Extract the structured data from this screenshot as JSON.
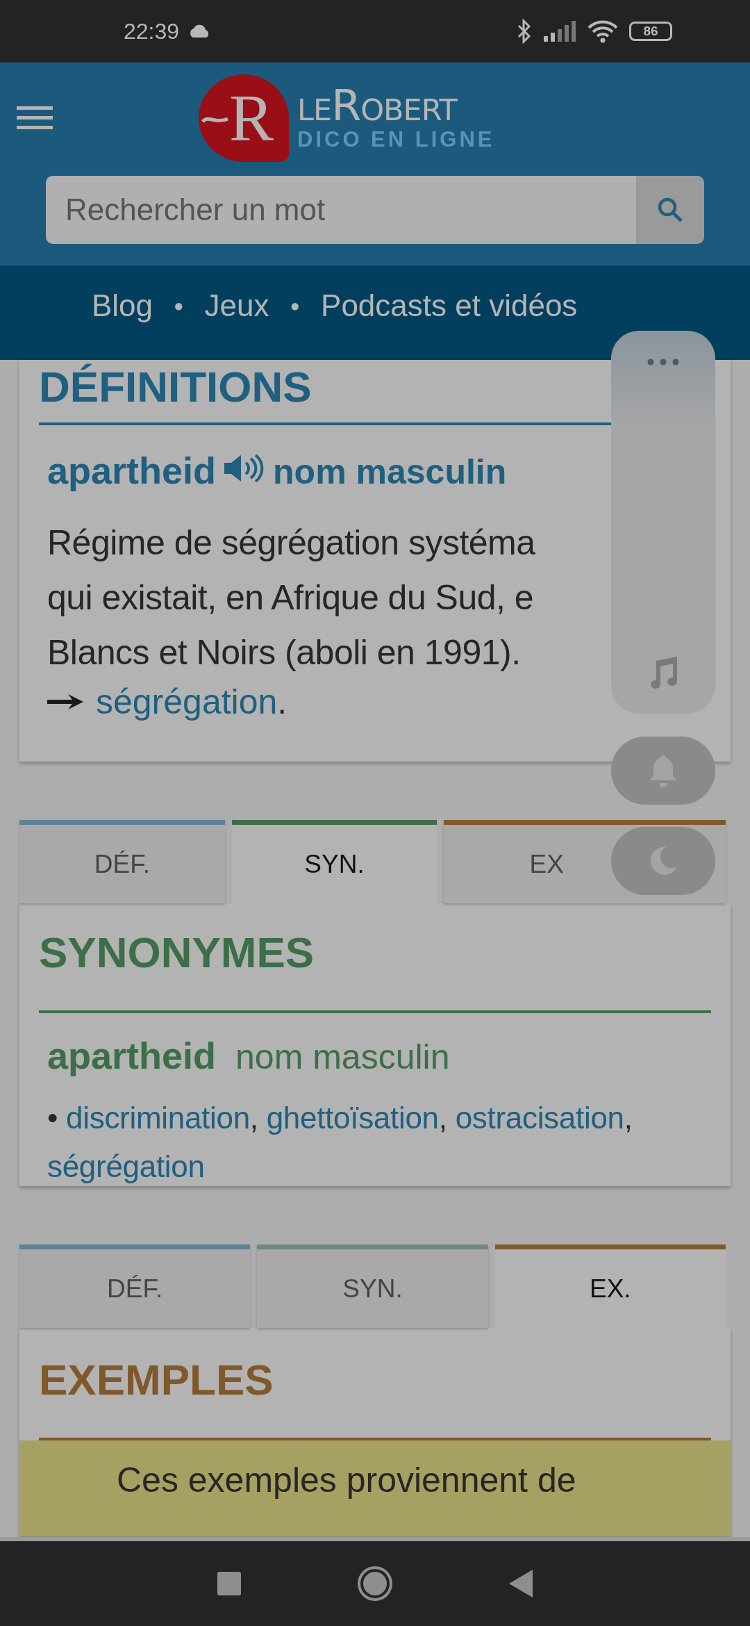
{
  "status_bar": {
    "time": "22:39",
    "battery": "86"
  },
  "header": {
    "logo_letter": "R",
    "logo_word": "leRobert",
    "logo_sub": "DICO EN LIGNE",
    "search": {
      "placeholder": "Rechercher un mot"
    }
  },
  "nav_links": [
    "Blog",
    "Jeux",
    "Podcasts et vidéos"
  ],
  "nav_separator": "●",
  "definitions": {
    "heading": "DÉFINITIONS",
    "headword": "apartheid",
    "category": "nom masculin",
    "lines": [
      "Régime de ségrégation systéma",
      "qui existait, en Afrique du Sud, e",
      "Blancs et Noirs (aboli en 1991)."
    ],
    "see_also": "ségrégation",
    "see_also_end": "."
  },
  "tabs_1": [
    {
      "label": "DÉF.",
      "kind": "def",
      "selected": false
    },
    {
      "label": "SYN.",
      "kind": "syn",
      "selected": true
    },
    {
      "label": "EX",
      "kind": "ex",
      "selected": false
    }
  ],
  "synonyms": {
    "heading": "SYNONYMES",
    "headword": "apartheid",
    "category": "nom masculin",
    "bullet": "•",
    "items": [
      {
        "word": "discrimination",
        "sep": ","
      },
      {
        "word": "ghettoïsation",
        "sep": ","
      },
      {
        "word": "ostracisation",
        "sep": ","
      },
      {
        "word": "ségrégation"
      }
    ]
  },
  "tabs_2": [
    {
      "label": "DÉF.",
      "kind": "def",
      "selected": false
    },
    {
      "label": "SYN.",
      "kind": "syn",
      "selected": false
    },
    {
      "label": "EX.",
      "kind": "ex",
      "selected": true
    }
  ],
  "examples": {
    "heading": "EXEMPLES",
    "notice": "Ces exemples proviennent de"
  }
}
